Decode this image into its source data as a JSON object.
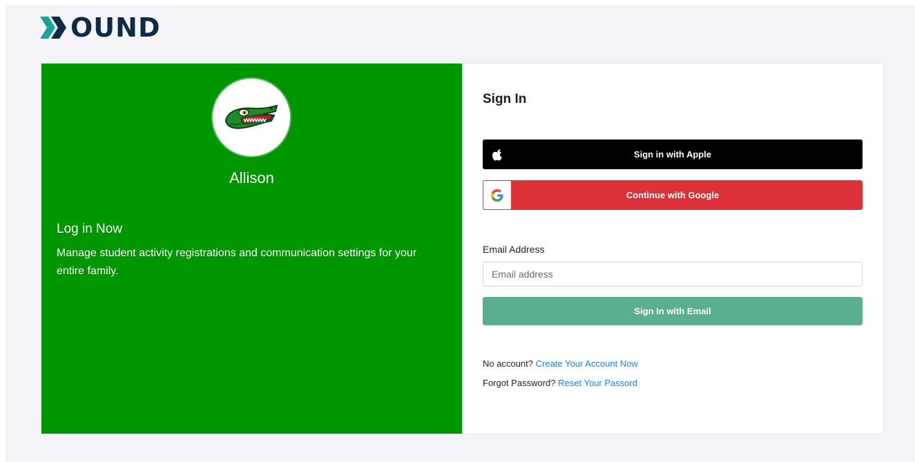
{
  "brand": {
    "name": "BOUND",
    "name_display": "OUND",
    "mark_color": "#1aa39a",
    "text_color": "#0f2a44"
  },
  "left_panel": {
    "background": "#009600",
    "org_name": "Allison",
    "logo_icon": "alligator-mascot-icon",
    "title": "Log in Now",
    "description": "Manage student activity registrations and communication settings for your entire family."
  },
  "signin": {
    "title": "Sign In",
    "apple_label": "Sign in with Apple",
    "google_label": "Continue with Google",
    "email_label": "Email Address",
    "email_placeholder": "Email address",
    "email_value": "",
    "email_button": "Sign In with Email",
    "no_account_text": "No account?",
    "create_account_link": "Create Your Account Now",
    "forgot_text": "Forgot Password?",
    "reset_link": "Reset Your Passord"
  },
  "colors": {
    "apple": "#000000",
    "google": "#dc3139",
    "email_button": "#5aaf8c",
    "link": "#1c7fe0"
  }
}
